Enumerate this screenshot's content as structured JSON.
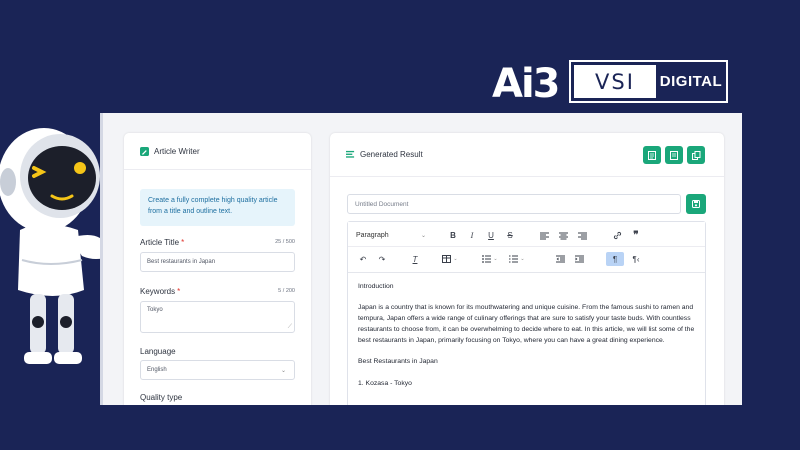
{
  "brand": {
    "logo_ai3": "Ai3",
    "logo_vsi": "VSI",
    "logo_digital": "DIGITAL"
  },
  "left_panel": {
    "title": "Article Writer",
    "info_text": "Create a fully complete high quality article from a title and outline text.",
    "article_title": {
      "label": "Article Title",
      "counter": "25 / 500",
      "value": "Best restaurants in Japan"
    },
    "keywords": {
      "label": "Keywords",
      "counter": "5 / 200",
      "value": "Tokyo"
    },
    "language": {
      "label": "Language",
      "value": "English"
    },
    "quality_type": {
      "label": "Quality type"
    }
  },
  "right_panel": {
    "title": "Generated Result",
    "doc_placeholder": "Untitled Document",
    "toolbar": {
      "paragraph_style": "Paragraph"
    },
    "content": {
      "heading1": "Introduction",
      "paragraph1": "Japan is a country that is known for its mouthwatering and unique cuisine. From the famous sushi to ramen and tempura, Japan offers a wide range of culinary offerings that are sure to satisfy your taste buds. With countless restaurants to choose from, it can be overwhelming to decide where to eat. In this article, we will list some of the best restaurants in Japan, primarily focusing on Tokyo, where you can have a great dining experience.",
      "heading2": "Best Restaurants in Japan",
      "item1": "1. Kozasa - Tokyo"
    }
  },
  "colors": {
    "background": "#1a2456",
    "accent_green": "#1aa77a",
    "info_bg": "#e6f4fb",
    "info_text": "#1e6fa0",
    "required": "#e0342c"
  }
}
